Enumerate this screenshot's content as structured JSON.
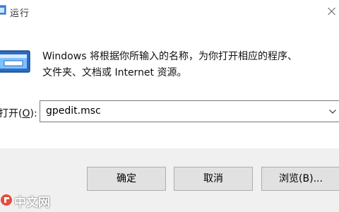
{
  "window": {
    "title": "运行",
    "close_icon": "close-icon"
  },
  "dialog": {
    "app_icon": "run-app-icon",
    "description_line1": "Windows 将根据你所输入的名称，为你打开相应的程序、",
    "description_line2": "文件夹、文档或 Internet 资源。"
  },
  "open_field": {
    "label_prefix": "打开(",
    "label_accel": "O",
    "label_suffix": "):",
    "value": "gpedit.msc",
    "dropdown_icon": "chevron-down-icon"
  },
  "buttons": {
    "ok": "确定",
    "cancel": "取消",
    "browse": "浏览(B)..."
  },
  "watermark": {
    "text": "中文网",
    "logo_icon": "php-logo-icon"
  },
  "colors": {
    "window_bg": "#ffffff",
    "footer_bg": "#f0f0f0",
    "button_bg": "#e1e1e1",
    "button_border": "#adadad",
    "input_border": "#7a7a7a",
    "watermark_red": "#e84c3d"
  }
}
